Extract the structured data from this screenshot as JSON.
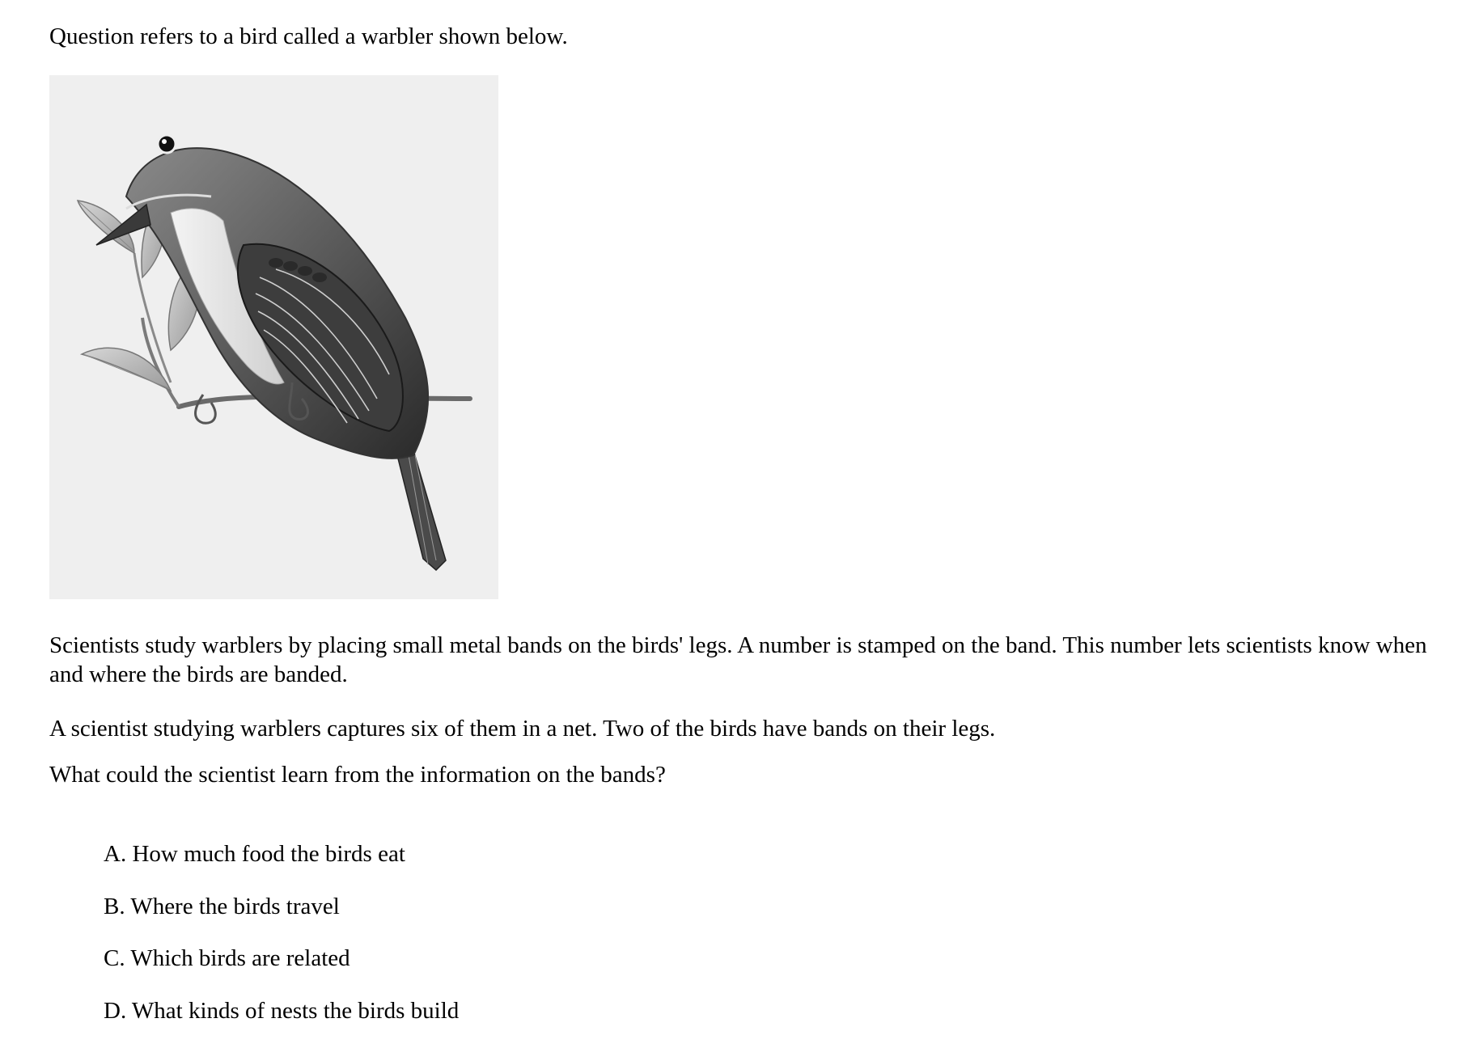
{
  "intro_text": "Question refers to a bird called a warbler shown below.",
  "figure": {
    "subject": "warbler-illustration",
    "background_color": "#efefef"
  },
  "passage": {
    "paragraph_1": "Scientists study warblers by placing small metal bands on the birds' legs. A number is stamped on the band. This number lets scientists know when and where the birds are banded.",
    "paragraph_2": "A scientist studying warblers captures six of them in a net. Two of the birds have bands on their legs."
  },
  "question": "What could the scientist learn from the information on the bands?",
  "options": [
    "A. How much food the birds eat",
    "B. Where the birds travel",
    "C. Which birds are related",
    "D. What kinds of nests the birds build"
  ]
}
